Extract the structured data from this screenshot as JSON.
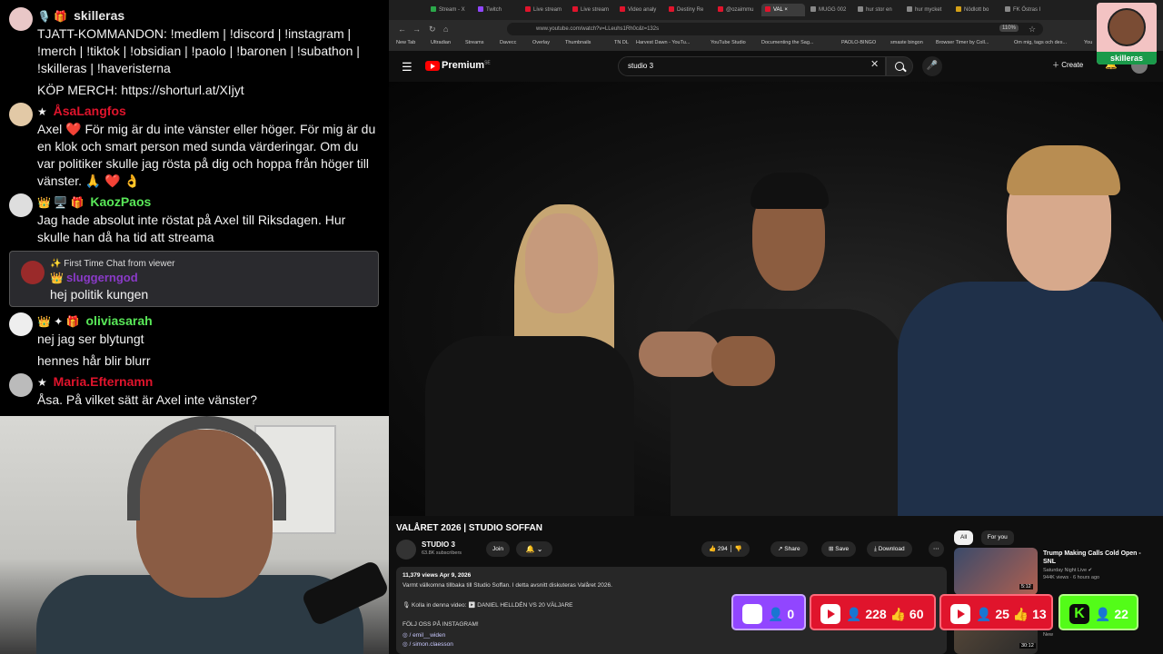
{
  "chat": {
    "messages": [
      {
        "user": "skilleras",
        "color": "#e8e8e8",
        "badges": "🎙️ 🎁",
        "lines": [
          "TJATT-KOMMANDON: !medlem | !discord | !instagram |",
          "!merch | !tiktok | !obsidian | !paolo | !baronen | !subathon |",
          "!skilleras | !haveristerna",
          "KÖP MERCH: https://shorturl.at/XIjyt"
        ]
      },
      {
        "user": "ÅsaLangfos",
        "color": "#e0142c",
        "badges": "★",
        "lines": [
          "Axel ❤️ För mig är du inte vänster eller höger. För mig är du",
          "en klok och smart person med sunda värderingar. Om du",
          "var politiker skulle jag rösta på dig och hoppa från höger till",
          "vänster. 🙏 ❤️ 👌"
        ]
      },
      {
        "user": "KaozPaos",
        "color": "#59e858",
        "badges": "👑 🖥️ 🎁",
        "lines": [
          "Jag hade absolut inte röstat på Axel till Riksdagen. Hur",
          "skulle han då ha tid att streama"
        ]
      },
      {
        "user": "oliviasarah",
        "color": "#59e858",
        "badges": "👑 ✦ 🎁",
        "lines": [
          "nej jag ser blytungt",
          "hennes hår blir blurr"
        ]
      },
      {
        "user": "Maria.Efternamn",
        "color": "#e0142c",
        "badges": "★",
        "lines": [
          "Åsa. På vilket sätt är Axel inte vänster?"
        ]
      }
    ],
    "highlight": {
      "title": "✨ First Time Chat from viewer",
      "badge": "👑",
      "user": "sluggerngod",
      "text": "hej politik kungen"
    }
  },
  "browser": {
    "tabs": [
      "Stream - X",
      "Twitch",
      "Live stream",
      "Live stream",
      "Video analy",
      "Destiny Re",
      "@ozaimmu",
      "VAL ×",
      "MUGG 002",
      "hur stor en",
      "hur mycket",
      "Nödlott bo",
      "FK Östras I"
    ],
    "url": "www.youtube.com/watch?v=LLeuhs1Rh0c&t=132s",
    "zoom": "110%",
    "bookmarks": [
      "New Tab",
      "Ultradian",
      "Streams",
      "Davecc",
      "Overlay",
      "Thumbnails",
      "TN DL",
      "Harvest Dawn - YouTu...",
      "YouTube Studio",
      "Documenting the Sag...",
      "PAOLO-BINGO",
      "smaste bingon",
      "Browser Timer by Coll...",
      "Om mig, tags och des...",
      "You"
    ]
  },
  "youtube": {
    "logo": "Premium",
    "region": "SE",
    "search": "studio 3",
    "create": "Create",
    "video": {
      "title": "VALÅRET 2026 | STUDIO SOFFAN",
      "channel": "STUDIO 3",
      "subs": "63.8K subscribers",
      "join": "Join",
      "likes": "294",
      "share": "Share",
      "save": "Save",
      "download": "Download"
    },
    "description": {
      "meta": "11,379 views  Apr 9, 2026",
      "lines": [
        "Varmt välkomna tillbaka till Studio Soffan. I detta avsnitt diskuteras Valåret 2026.",
        "🎙 Kolla in denna video:  ▶ DANIEL HELLDÉN VS 20 VÄLJARE",
        "FÖLJ OSS PÅ INSTAGRAM!",
        "◎ / emil__widen",
        "◎ / simon.claesson"
      ]
    },
    "chips": [
      "All",
      "For you"
    ],
    "recs": [
      {
        "title": "Trump Making Calls Cold Open - SNL",
        "channel": "Saturday Night Live ✔",
        "views": "944K views · 6 hours ago",
        "duration": "5:12"
      },
      {
        "title": "",
        "channel": "",
        "views": "New",
        "duration": "30:12"
      }
    ]
  },
  "overlay": {
    "logo_name": "skilleras",
    "twitch": "0",
    "yt1_viewers": "228",
    "yt1_likes": "60",
    "yt2_viewers": "25",
    "yt2_likes": "13",
    "kick": "22"
  }
}
